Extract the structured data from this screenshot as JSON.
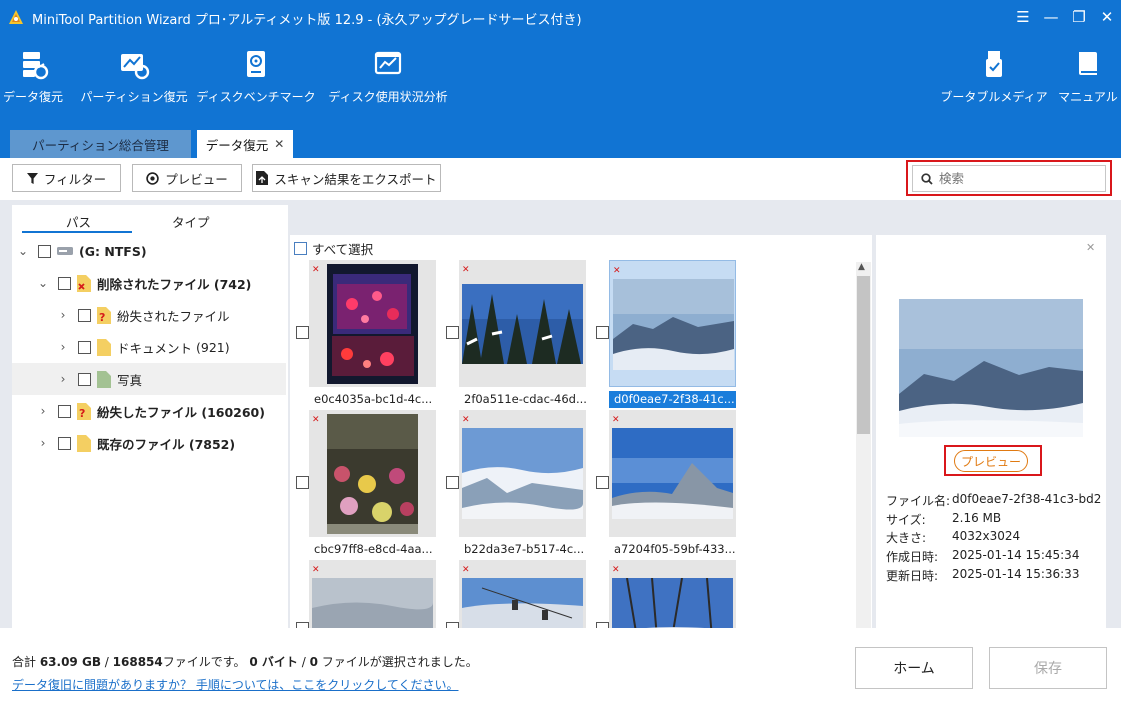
{
  "window": {
    "title": "MiniTool Partition Wizard プロ･アルティメット版 12.9 - (永久アップグレードサービス付き)",
    "min_glyph": "—",
    "max_glyph": "❐",
    "close_glyph": "✕",
    "menu_glyph": "☰"
  },
  "ribbon": {
    "items": [
      {
        "label": "データ復元",
        "icon": "data-recovery-icon"
      },
      {
        "label": "パーティション復元",
        "icon": "partition-recovery-icon"
      },
      {
        "label": "ディスクベンチマーク",
        "icon": "disk-benchmark-icon"
      },
      {
        "label": "ディスク使用状況分析",
        "icon": "space-analyzer-icon"
      }
    ],
    "right_items": [
      {
        "label": "ブータブルメディア",
        "icon": "bootable-media-icon"
      },
      {
        "label": "マニュアル",
        "icon": "manual-icon"
      }
    ]
  },
  "tabs": [
    {
      "label": "パーティション総合管理",
      "active": false
    },
    {
      "label": "データ復元",
      "active": true,
      "close": "✕"
    }
  ],
  "toolbar": {
    "filter_label": "フィルター",
    "preview_label": "プレビュー",
    "export_label": "スキャン結果をエクスポート",
    "search_placeholder": "検索"
  },
  "left": {
    "tab_path": "パス",
    "tab_type": "タイプ",
    "tree": [
      {
        "label": "(G: NTFS)",
        "bold": true,
        "indent": 0,
        "chevron": "down",
        "icon": "drive-icon"
      },
      {
        "label": "削除されたファイル (742)",
        "bold": true,
        "indent": 1,
        "chevron": "down",
        "icon": "deleted-folder-icon"
      },
      {
        "label": "紛失されたファイル",
        "bold": false,
        "indent": 2,
        "chevron": "right",
        "icon": "lost-folder-icon"
      },
      {
        "label": "ドキュメント",
        "count": "(921)",
        "bold": false,
        "indent": 2,
        "chevron": "right",
        "icon": "folder-icon"
      },
      {
        "label": "写真",
        "bold": false,
        "indent": 2,
        "chevron": "right",
        "icon": "photo-folder-icon",
        "highlight": true
      },
      {
        "label": "紛失したファイル (160260)",
        "bold": true,
        "indent": 1,
        "chevron": "right",
        "icon": "lost-folder-icon"
      },
      {
        "label": "既存のファイル (7852)",
        "bold": true,
        "indent": 1,
        "chevron": "right",
        "icon": "folder-icon"
      }
    ]
  },
  "center": {
    "select_all": "すべて選択",
    "deleted_mark": "✕",
    "files": [
      {
        "name": "e0c4035a-bc1d-4c...",
        "selected": false,
        "theme": "aquarium"
      },
      {
        "name": "2f0a511e-cdac-46d...",
        "selected": false,
        "theme": "trees"
      },
      {
        "name": "d0f0eae7-2f38-41c...",
        "selected": true,
        "theme": "mountain-blue"
      },
      {
        "name": "cbc97ff8-e8cd-4aa...",
        "selected": false,
        "theme": "flowers"
      },
      {
        "name": "b22da3e7-b517-4c...",
        "selected": false,
        "theme": "clouds"
      },
      {
        "name": "a7204f05-59bf-433...",
        "selected": false,
        "theme": "peak"
      },
      {
        "name": "",
        "selected": false,
        "theme": "fog"
      },
      {
        "name": "",
        "selected": false,
        "theme": "ski"
      },
      {
        "name": "",
        "selected": false,
        "theme": "branches"
      }
    ]
  },
  "preview": {
    "close_glyph": "✕",
    "button_label": "プレビュー",
    "fields": [
      {
        "key": "ファイル名:",
        "value": "d0f0eae7-2f38-41c3-bd2"
      },
      {
        "key": "サイズ:",
        "value": "2.16 MB"
      },
      {
        "key": "大きさ:",
        "value": "4032x3024"
      },
      {
        "key": "作成日時:",
        "value": "2025-01-14 15:45:34"
      },
      {
        "key": "更新日時:",
        "value": "2025-01-14 15:36:33"
      }
    ]
  },
  "footer": {
    "summary_prefix": "合計 ",
    "total_size": "63.09 GB",
    "separator": " / ",
    "file_count": "168854",
    "summary_mid": "ファイルです。 ",
    "selected_size": "0 バイト",
    "separator2": " / ",
    "selected_count": "0",
    "summary_suffix": " ファイルが選択されました。",
    "help_link": "データ復旧に問題がありますか？ 手順については、ここをクリックしてください。",
    "home_label": "ホーム",
    "save_label": "保存"
  },
  "colors": {
    "accent": "#1174d3",
    "highlight_box": "#d9171b",
    "preview_button": "#e07a12",
    "selected_caption": "#1a7ddb"
  }
}
